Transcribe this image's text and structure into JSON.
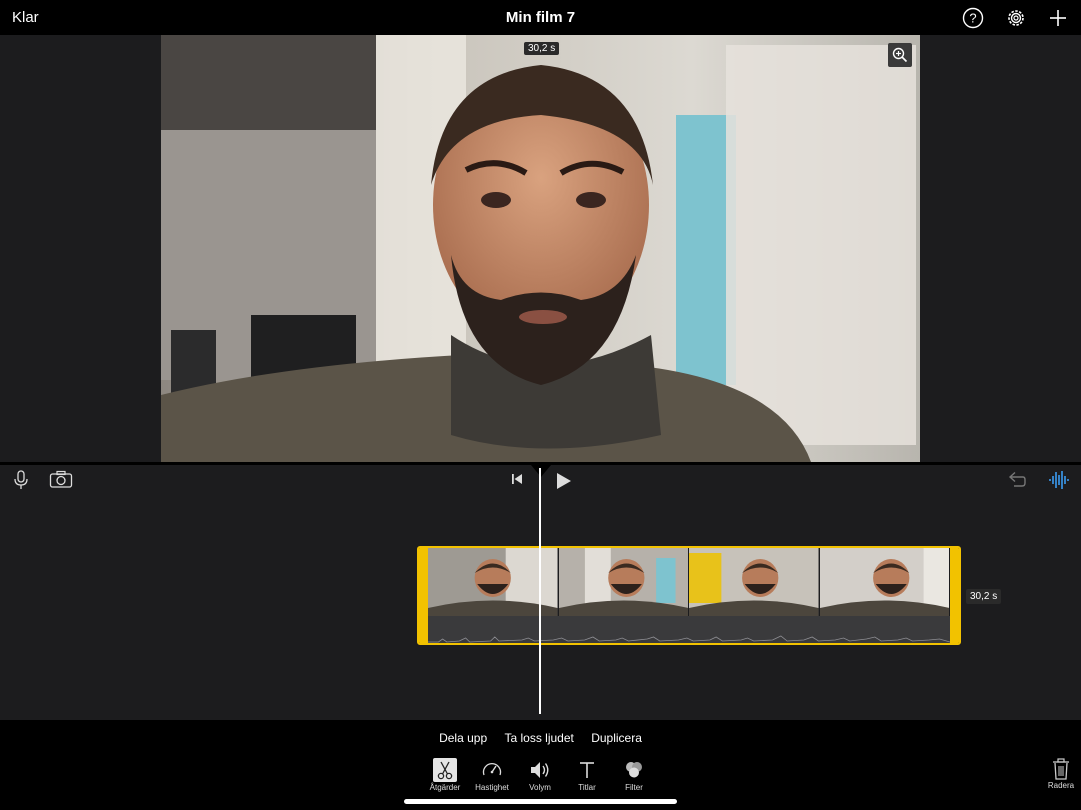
{
  "topbar": {
    "done_label": "Klar",
    "title": "Min film 7",
    "icons": [
      "help-icon",
      "settings-gear-icon",
      "add-plus-icon"
    ]
  },
  "viewer": {
    "time": "30,2 s",
    "zoom_icon": "zoom-in-icon"
  },
  "timeline": {
    "left_icons": [
      "microphone-icon",
      "camera-icon"
    ],
    "transport_icons": [
      "skip-to-start-icon",
      "play-icon"
    ],
    "right_icons": [
      "undo-icon",
      "audio-waveform-icon"
    ],
    "clip_duration": "30,2 s"
  },
  "actions": {
    "split": "Dela upp",
    "detach_audio": "Ta loss ljudet",
    "duplicate": "Duplicera"
  },
  "tabs": [
    {
      "label": "Åtgärder",
      "icon": "scissors-icon",
      "active": true
    },
    {
      "label": "Hastighet",
      "icon": "speedometer-icon",
      "active": false
    },
    {
      "label": "Volym",
      "icon": "speaker-icon",
      "active": false
    },
    {
      "label": "Titlar",
      "icon": "text-t-icon",
      "active": false
    },
    {
      "label": "Filter",
      "icon": "filter-circles-icon",
      "active": false
    }
  ],
  "delete": {
    "label": "Radera",
    "icon": "trash-icon"
  },
  "colors": {
    "accent_yellow": "#f2c200",
    "waveform_blue": "#3a9bf0"
  }
}
